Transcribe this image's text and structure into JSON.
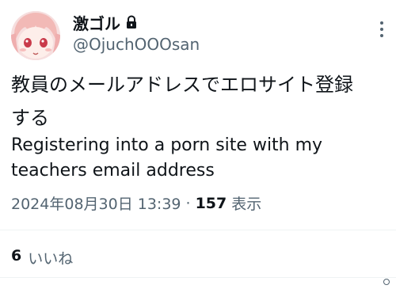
{
  "post": {
    "author": {
      "display_name": "激ゴル",
      "handle": "@OjuchOOOsan",
      "protected_icon": "lock-icon",
      "avatar_icon": "anime-girl-avatar"
    },
    "text_japanese_line1": "教員のメールアドレスでエロサイト登録",
    "text_japanese_line2": "する",
    "text_english_line1": "Registering into a porn site with my",
    "text_english_line2": "teachers email address",
    "timestamp": "2024年08月30日 13:39",
    "separator": "·",
    "views_count": "157",
    "views_label": "表示",
    "likes_count": "6",
    "likes_label": "いいね",
    "more_icon": "more-vertical-icon"
  },
  "colors": {
    "text_primary": "#0f1419",
    "text_secondary": "#536471",
    "divider": "#eff3f4",
    "background": "#ffffff"
  }
}
